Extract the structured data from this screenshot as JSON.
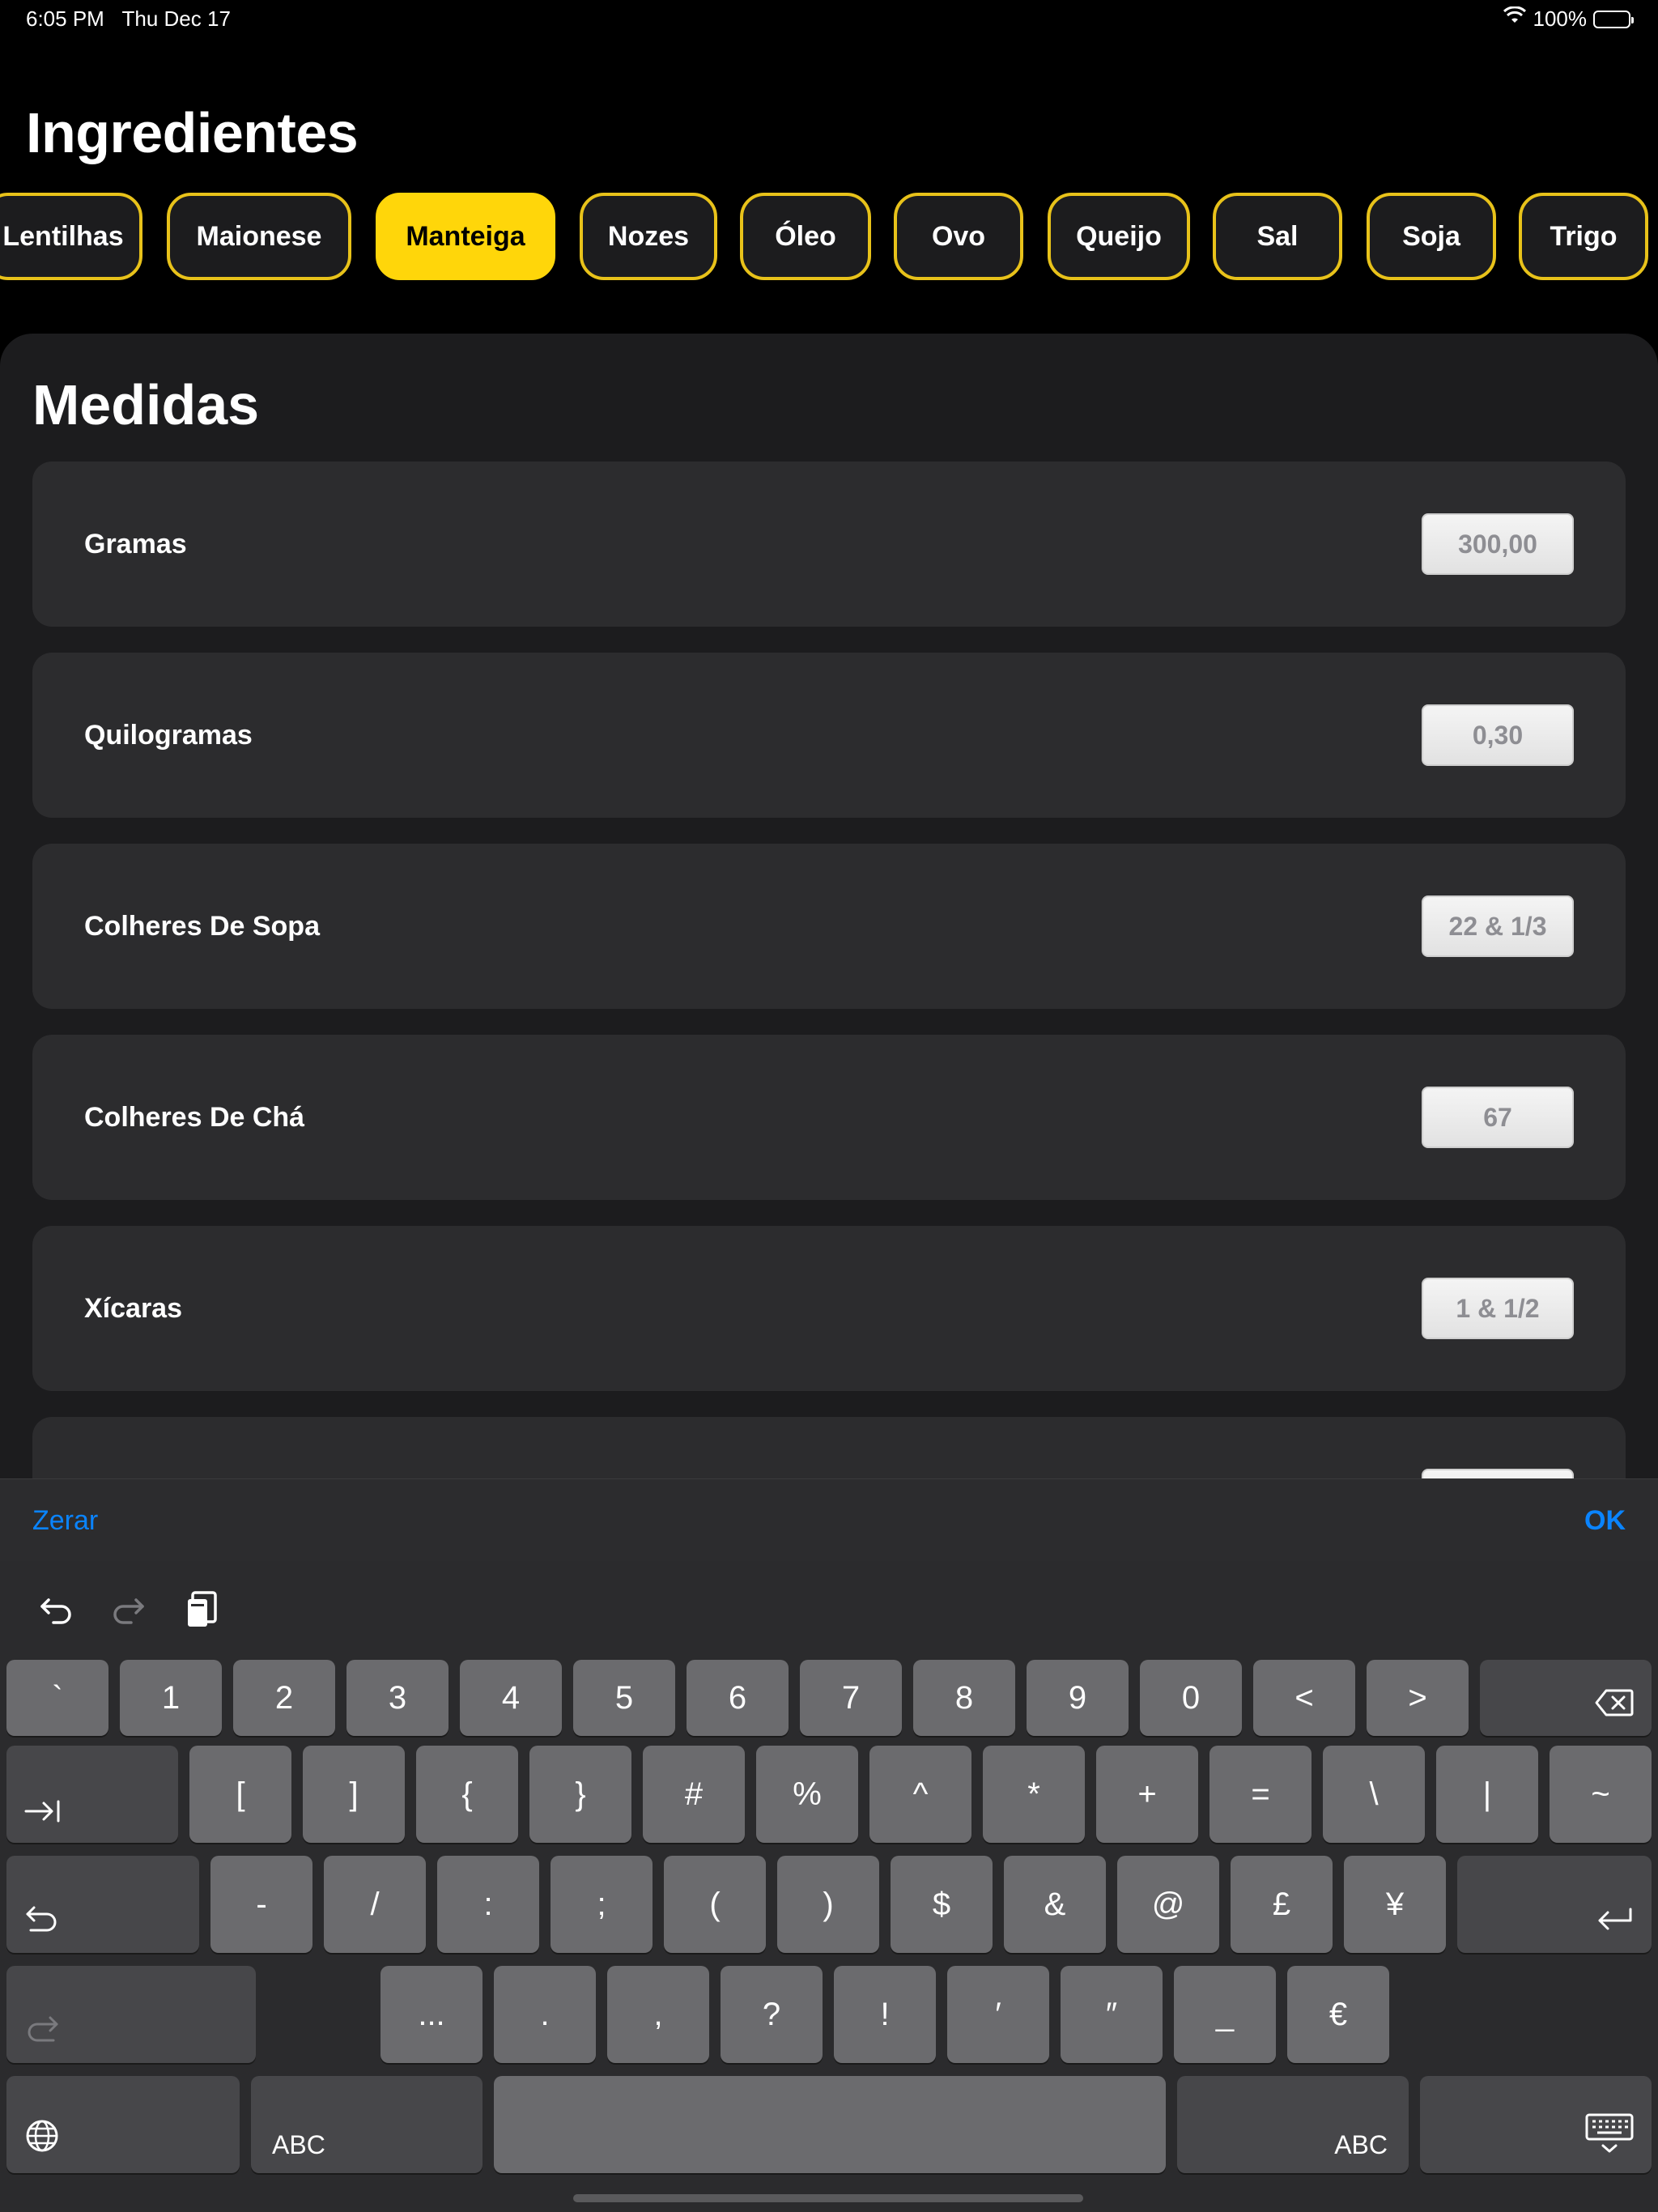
{
  "status": {
    "time": "6:05 PM",
    "date": "Thu Dec 17",
    "battery": "100%"
  },
  "title": "Ingredientes",
  "chips": [
    "Lentilhas",
    "Maionese",
    "Manteiga",
    "Nozes",
    "Óleo",
    "Ovo",
    "Queijo",
    "Sal",
    "Soja",
    "Trigo"
  ],
  "active_chip": "Manteiga",
  "sheet": {
    "title": "Medidas",
    "rows": [
      {
        "label": "Gramas",
        "value": "300,00"
      },
      {
        "label": "Quilogramas",
        "value": "0,30"
      },
      {
        "label": "Colheres De Sopa",
        "value": "22 & 1/3"
      },
      {
        "label": "Colheres De Chá",
        "value": "67"
      },
      {
        "label": "Xícaras",
        "value": "1 & 1/2"
      },
      {
        "label": "",
        "value": ""
      }
    ]
  },
  "accessory": {
    "reset_label": "Zerar",
    "ok_label": "OK"
  },
  "keyboard": {
    "row1": [
      "`",
      "1",
      "2",
      "3",
      "4",
      "5",
      "6",
      "7",
      "8",
      "9",
      "0",
      "<",
      ">"
    ],
    "row2": [
      "[",
      "]",
      "{",
      "}",
      "#",
      "%",
      "^",
      "*",
      "+",
      "=",
      "\\",
      "|",
      "~"
    ],
    "row3": [
      "-",
      "/",
      ":",
      ";",
      "(",
      ")",
      "$",
      "&",
      "@",
      "£",
      "¥"
    ],
    "row4": [
      "...",
      ".",
      ",",
      "?",
      "!",
      "′",
      "″",
      "_",
      "€"
    ],
    "abc_left": "ABC",
    "abc_right": "ABC"
  }
}
